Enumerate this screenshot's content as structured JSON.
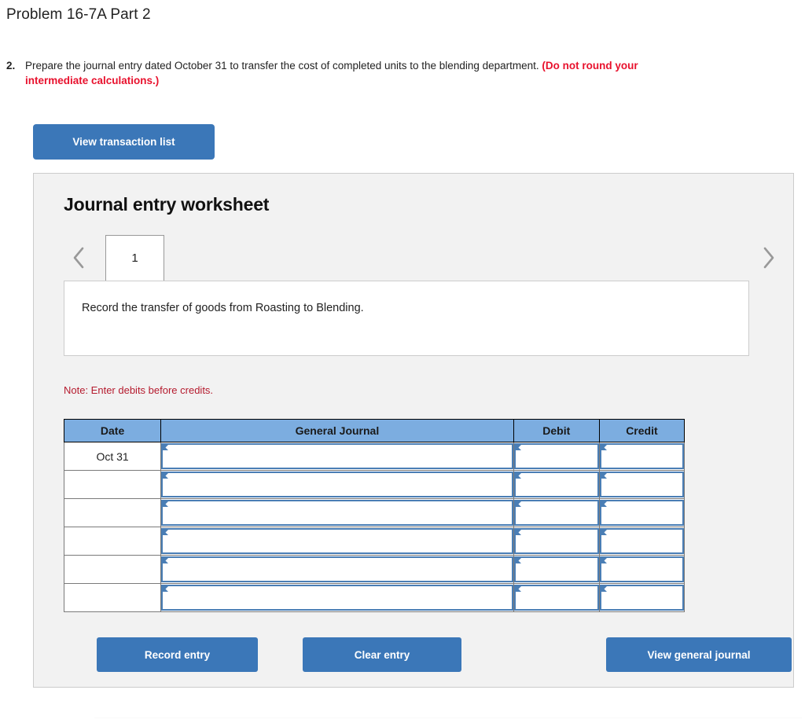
{
  "page": {
    "title": "Problem 16-7A Part 2"
  },
  "question": {
    "number": "2.",
    "text": "Prepare the journal entry dated October 31 to transfer the cost of completed units to the blending department. ",
    "emphasis": "(Do not round your intermediate calculations.)"
  },
  "toolbar": {
    "view_transaction_list_label": "View transaction list"
  },
  "worksheet": {
    "heading": "Journal entry worksheet",
    "prev_icon": "chevron-left-icon",
    "next_icon": "chevron-right-icon",
    "tabs": [
      {
        "label": "1",
        "selected": true
      }
    ],
    "description": "Record the transfer of goods from Roasting to Blending.",
    "note": "Note: Enter debits before credits.",
    "table": {
      "headers": [
        "Date",
        "General Journal",
        "Debit",
        "Credit"
      ],
      "rows": [
        {
          "date": "Oct 31",
          "general_journal": "",
          "debit": "",
          "credit": ""
        },
        {
          "date": "",
          "general_journal": "",
          "debit": "",
          "credit": ""
        },
        {
          "date": "",
          "general_journal": "",
          "debit": "",
          "credit": ""
        },
        {
          "date": "",
          "general_journal": "",
          "debit": "",
          "credit": ""
        },
        {
          "date": "",
          "general_journal": "",
          "debit": "",
          "credit": ""
        },
        {
          "date": "",
          "general_journal": "",
          "debit": "",
          "credit": ""
        }
      ]
    },
    "actions": {
      "record_entry_label": "Record entry",
      "clear_entry_label": "Clear entry",
      "view_general_journal_label": "View general journal"
    }
  },
  "colors": {
    "button_blue": "#3b77b8",
    "table_header_blue": "#7cade0",
    "input_border_blue": "#4a7eb5",
    "note_red": "#b51b2e",
    "emphasis_red": "#e8112d",
    "panel_gray": "#f2f2f2"
  }
}
